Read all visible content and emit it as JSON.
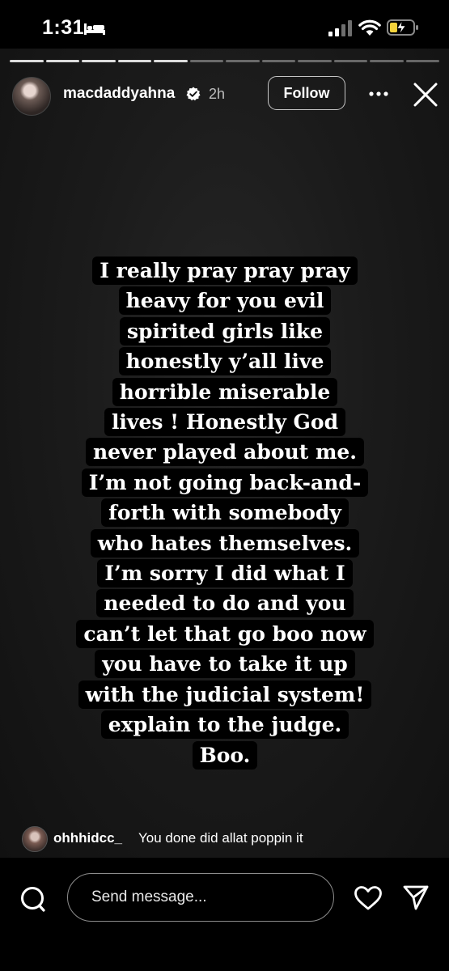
{
  "status_bar": {
    "time": "1:31",
    "icons": [
      "bed-icon",
      "signal-icon",
      "wifi-icon",
      "battery-charging-icon"
    ],
    "battery_color": "#f5d33b"
  },
  "story": {
    "progress_segments_total": 12,
    "progress_segments_viewed": 5,
    "username": "macdaddyahna",
    "verified": true,
    "time_ago": "2h",
    "follow_label": "Follow",
    "text_lines": [
      "I really pray pray pray",
      "heavy for you evil",
      "spirited girls like",
      "honestly y’all live",
      "horrible miserable",
      "lives ! Honestly God",
      "never played about me.",
      "I’m not going back-and-",
      "forth with somebody",
      "who hates themselves.",
      "I’m sorry I did what I",
      "needed to do and you",
      "can’t let that go boo now",
      "you have to take it up",
      "with the judicial system!",
      "explain to the judge.",
      "Boo."
    ]
  },
  "comment": {
    "username": "ohhhidcc_",
    "text": "You done did allat poppin it"
  },
  "footer": {
    "message_placeholder": "Send message..."
  }
}
